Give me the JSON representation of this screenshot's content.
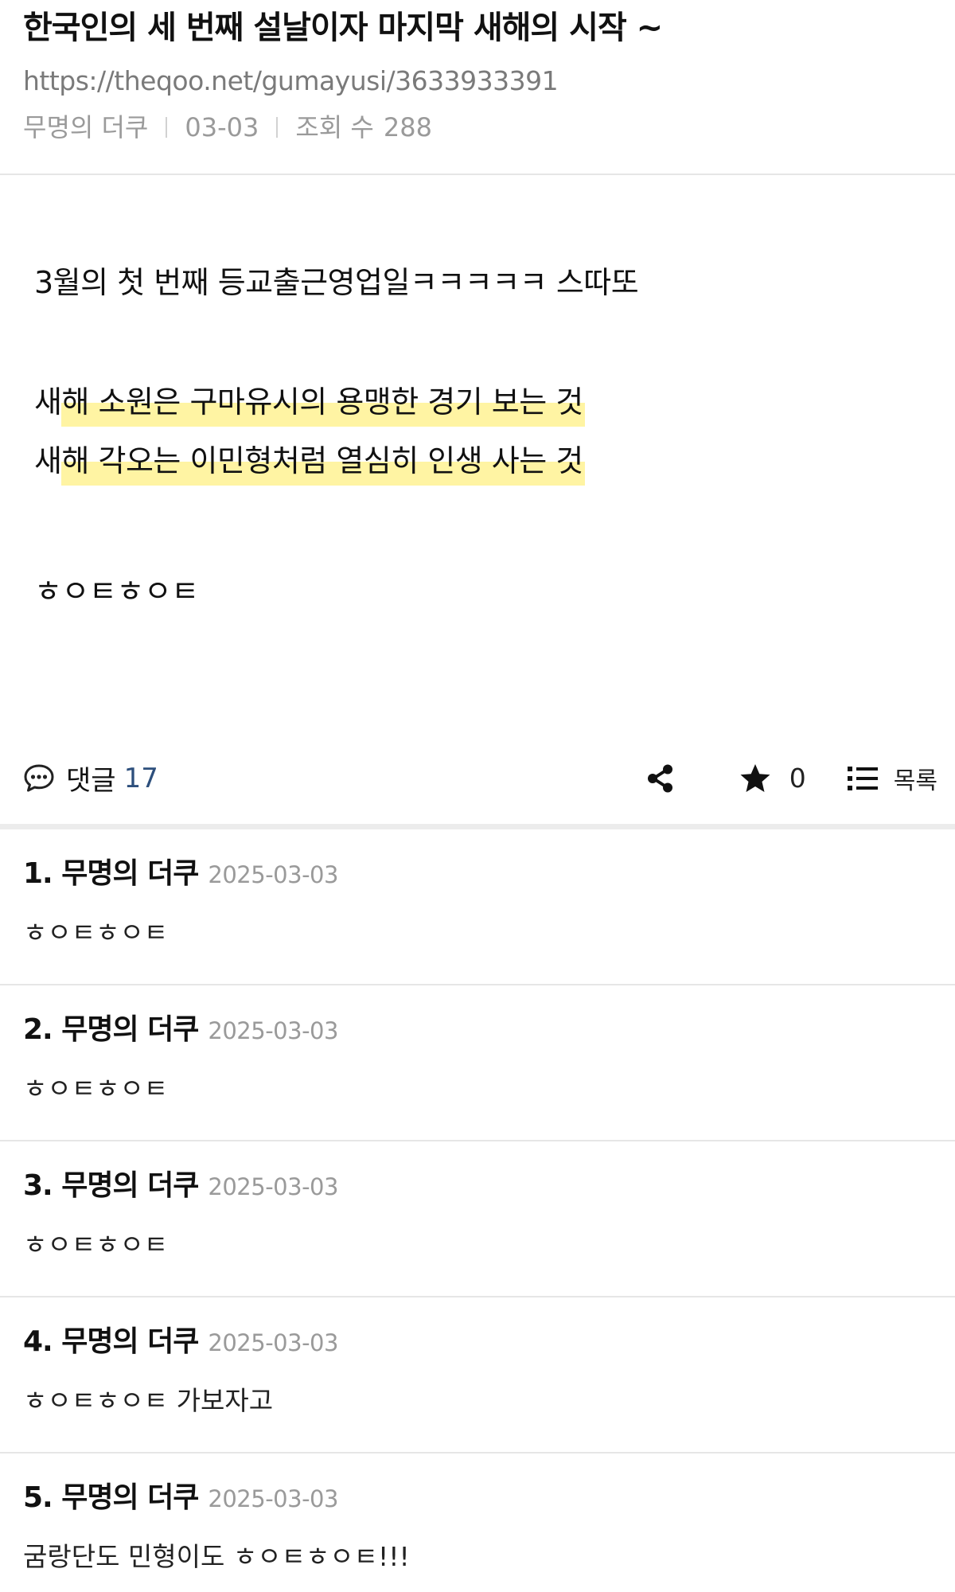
{
  "post": {
    "title": "한국인의 세 번째 설날이자 마지막 새해의 시작 ~",
    "url": "https://theqoo.net/gumayusi/3633933391",
    "author": "무명의 더쿠",
    "date": "03-03",
    "views_label": "조회 수",
    "views": "288",
    "body": {
      "line1": "3월의 첫 번째 등교출근영업일ㅋㅋㅋㅋㅋ 스따또",
      "line2_lead": "새",
      "line2_highlight": "해 소원은 구마유시의 용맹한 경기 보는 것",
      "line3_lead": "새",
      "line3_highlight": "해 각오는 이민형처럼 열심히 인생 사는 것",
      "line4": "ㅎㅇㅌㅎㅇㅌ"
    },
    "highlight_color": "#fff4a3"
  },
  "actions": {
    "comments_label": "댓글",
    "comments_count": "17",
    "share_icon": "share-icon",
    "star_icon": "star-icon",
    "star_count": "0",
    "list_icon": "list-icon",
    "list_label": "목록"
  },
  "comments": [
    {
      "author": "1. 무명의 더쿠",
      "date": "2025-03-03",
      "text": "ㅎㅇㅌㅎㅇㅌ"
    },
    {
      "author": "2. 무명의 더쿠",
      "date": "2025-03-03",
      "text": "ㅎㅇㅌㅎㅇㅌ"
    },
    {
      "author": "3. 무명의 더쿠",
      "date": "2025-03-03",
      "text": "ㅎㅇㅌㅎㅇㅌ"
    },
    {
      "author": "4. 무명의 더쿠",
      "date": "2025-03-03",
      "text": "ㅎㅇㅌㅎㅇㅌ 가보자고"
    },
    {
      "author": "5. 무명의 더쿠",
      "date": "2025-03-03",
      "text": "굼랑단도 민형이도 ㅎㅇㅌㅎㅇㅌ!!!"
    }
  ]
}
